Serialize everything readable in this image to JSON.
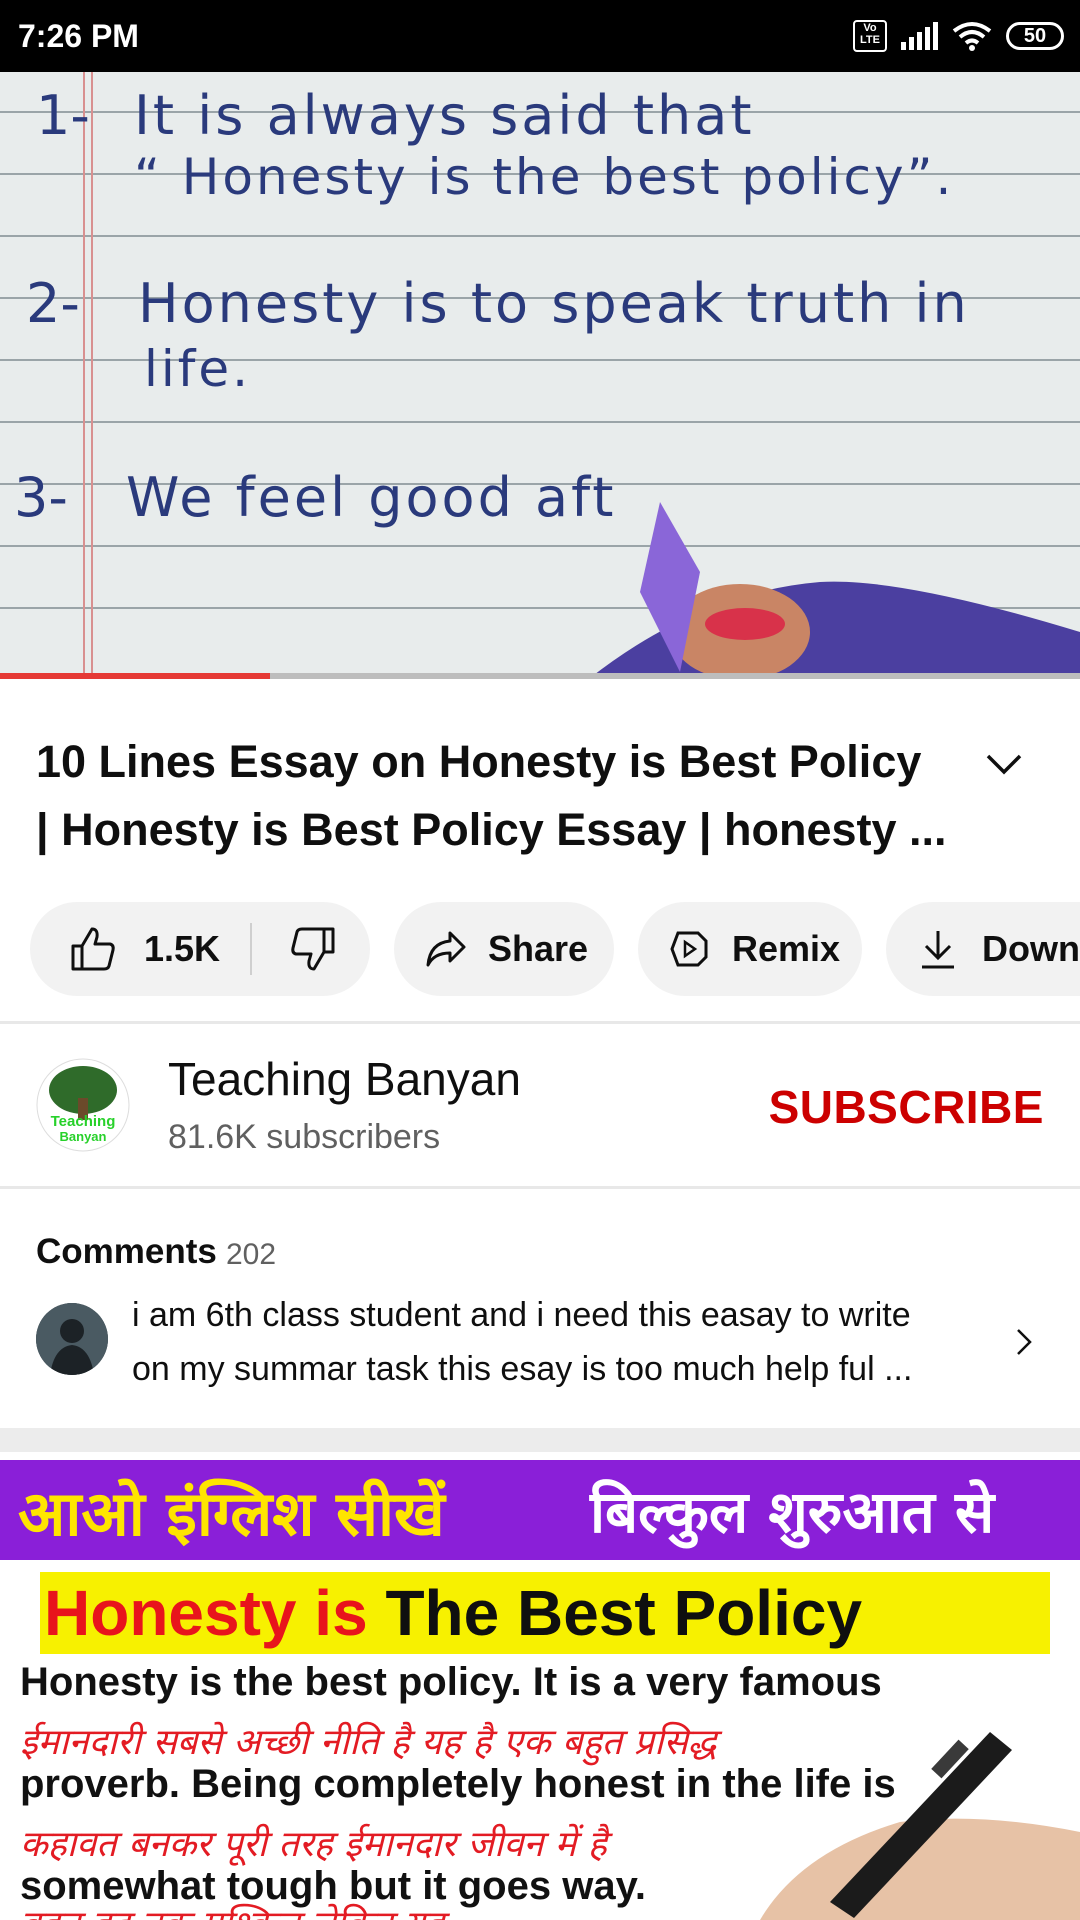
{
  "status_bar": {
    "time": "7:26 PM",
    "battery": "50",
    "volte": "Vo LTE"
  },
  "video": {
    "lines": [
      {
        "num": "1-",
        "text": "It  is  always  said  that"
      },
      {
        "num": "",
        "text": "“ Honesty  is  the  best  policy”."
      },
      {
        "num": "2-",
        "text": "Honesty  is  to  speak  truth  in"
      },
      {
        "num": "",
        "text": "life."
      },
      {
        "num": "3-",
        "text": "We  feel  good  aft"
      }
    ],
    "progress": 0.25
  },
  "title": {
    "line1": "10 Lines Essay on Honesty is Best Policy",
    "line2": "| Honesty is Best Policy Essay | honesty ..."
  },
  "actions": {
    "likes": "1.5K",
    "share": "Share",
    "remix": "Remix",
    "download": "Down"
  },
  "channel": {
    "name": "Teaching Banyan",
    "subscribers": "81.6K subscribers",
    "subscribe": "SUBSCRIBE",
    "logo_text_1": "Teaching",
    "logo_text_2": "Banyan"
  },
  "comments": {
    "label": "Comments",
    "count": "202",
    "top_line1": "i am 6th class student and i need this easay to write",
    "top_line2": "on my summar task this esay is too much help ful ..."
  },
  "next_thumbnail": {
    "band_left": "आओ इंग्लिश सीखें",
    "band_right": "बिल्कुल शुरुआत से",
    "title_red": "Honesty is",
    "title_black": "The Best Policy",
    "line1": "Honesty is the best policy. It is a very famous",
    "hindi1": "ईमानदारी सबसे अच्छी नीति है यह है एक बहुत प्रसिद्ध",
    "line2": "proverb. Being completely honest in the life is",
    "hindi2": "कहावत   बनकर   पूरी तरह   ईमानदार जीवन में है",
    "line3": "somewhat   tough       but  it  goes          way.",
    "hindi3": "बहुत हद तक   मुश्किल     लेकिन यह"
  },
  "colors": {
    "accent": "#cc0000",
    "progress": "#e53935",
    "band": "#8a1fd8",
    "highlight": "#f7f100"
  }
}
